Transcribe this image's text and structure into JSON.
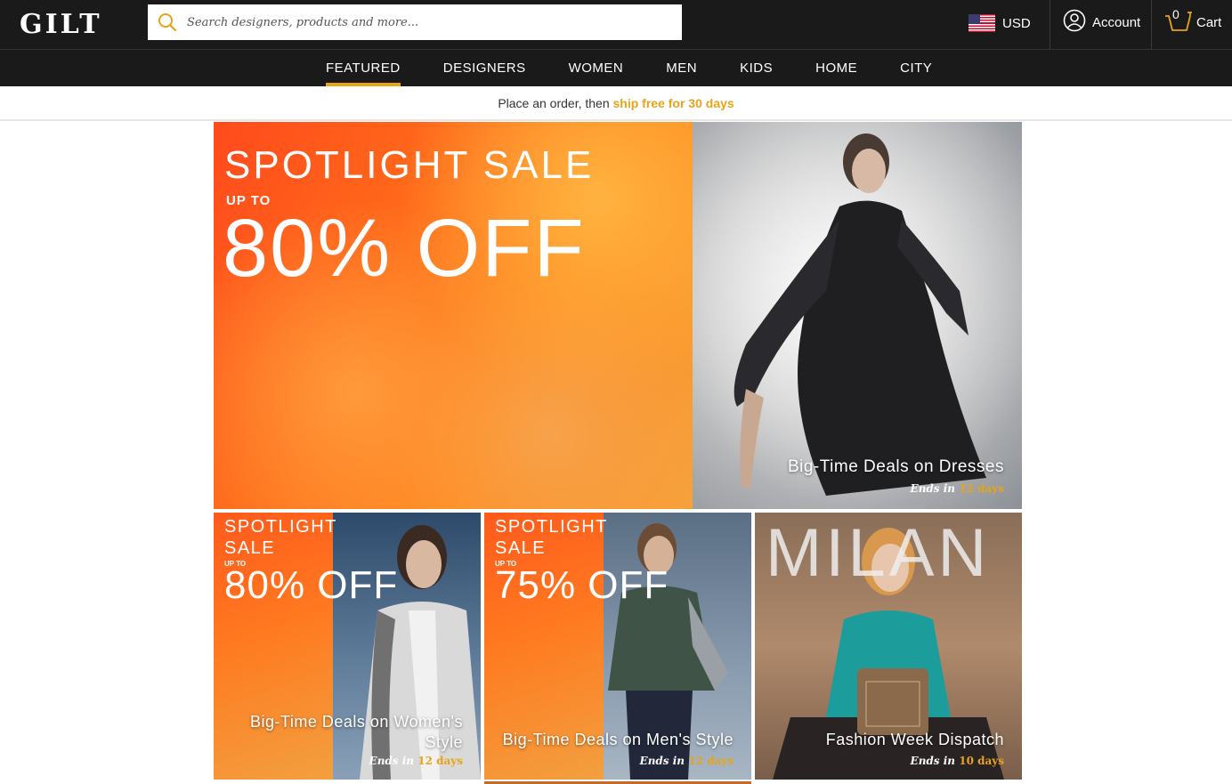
{
  "header": {
    "logo": "GILT",
    "search_placeholder": "Search designers, products and more...",
    "currency": "USD",
    "account_label": "Account",
    "cart_label": "Cart",
    "cart_count": "0"
  },
  "nav": {
    "items": [
      "FEATURED",
      "DESIGNERS",
      "WOMEN",
      "MEN",
      "KIDS",
      "HOME",
      "CITY"
    ],
    "active": "FEATURED"
  },
  "promo": {
    "text": "Place an order, then",
    "highlight": "ship free for 30 days"
  },
  "hero": {
    "headline": "SPOTLIGHT SALE",
    "upto": "UP TO",
    "discount": "80% OFF",
    "title": "Big-Time Deals on Dresses",
    "ends_label": "Ends in",
    "ends_value": "12 days"
  },
  "tiles": [
    {
      "line1": "SPOTLIGHT",
      "line2": "SALE",
      "upto": "UP TO",
      "discount": "80% OFF",
      "title": "Big-Time Deals on Women's Style",
      "ends_label": "Ends in",
      "ends_value": "12 days"
    },
    {
      "line1": "SPOTLIGHT",
      "line2": "SALE",
      "upto": "UP TO",
      "discount": "75% OFF",
      "title": "Big-Time Deals on Men's Style",
      "ends_label": "Ends in",
      "ends_value": "12 days"
    },
    {
      "brand": "MILAN",
      "title": "Fashion Week Dispatch",
      "ends_label": "Ends in",
      "ends_value": "10 days"
    }
  ],
  "colors": {
    "accent": "#e8a317",
    "header_bg": "#1a1a1a"
  }
}
